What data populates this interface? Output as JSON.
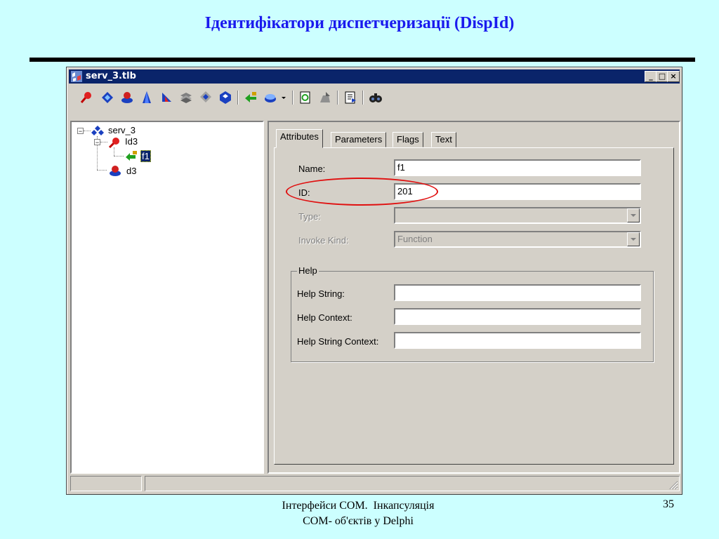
{
  "slide": {
    "title": "Ідентифікатори диспетчеризації (DispId)",
    "footer_line1": "Інтерфейси COM.  Інкапсуляція",
    "footer_line2": "COM- об'єктів у Delphi",
    "page_number": "35"
  },
  "window": {
    "title": "serv_3.tlb",
    "minimize": "_",
    "maximize": "□",
    "close": "×"
  },
  "toolbar": {
    "icons": [
      "new-interface-icon",
      "new-dispinterface-icon",
      "new-coclass-icon",
      "new-enum-icon",
      "new-alias-icon",
      "new-record-icon",
      "new-union-icon",
      "new-module-icon",
      "new-method-icon",
      "new-property-icon",
      "dropdown-arrow-icon",
      "refresh-icon",
      "register-icon",
      "export-icon",
      "find-icon"
    ]
  },
  "tree": {
    "root": "serv_3",
    "child1": "Id3",
    "child1_item": "f1",
    "child2": "d3"
  },
  "tabs": [
    "Attributes",
    "Parameters",
    "Flags",
    "Text"
  ],
  "attributes": {
    "name_label": "Name:",
    "name_value": "f1",
    "id_label": "ID:",
    "id_value": "201",
    "type_label": "Type:",
    "type_value": "",
    "invoke_label": "Invoke Kind:",
    "invoke_value": "Function"
  },
  "help": {
    "legend": "Help",
    "string_label": "Help String:",
    "string_value": "",
    "context_label": "Help Context:",
    "context_value": "",
    "string_context_label": "Help String Context:",
    "string_context_value": ""
  },
  "colors": {
    "slide_background": "#ccffff",
    "title_color": "#1a1aee",
    "titlebar": "#0a246a",
    "highlight": "#e01010"
  }
}
